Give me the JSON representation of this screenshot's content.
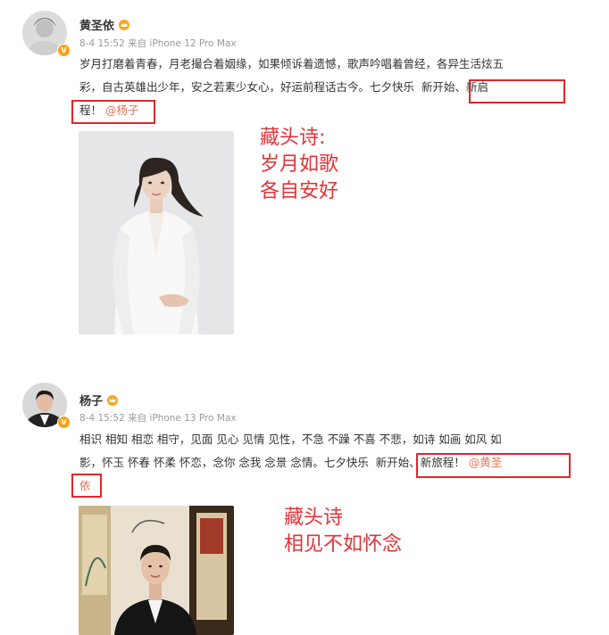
{
  "post1": {
    "username": "黄圣依",
    "meta": "8-4 15:52 来自 iPhone 12 Pro Max",
    "line1": "岁月打磨着青春，月老撮合着姻缘，如果倾诉着遗憾，歌声吟唱着曾经，各异生活炫五",
    "line2_a": "彩，自古英雄出少年，安之若素少女心，好运前程话古今。七夕快乐",
    "line2_b": "新开始、新启",
    "line3_a": "程！",
    "line3_mention": "@杨子",
    "annotation": [
      "藏头诗:",
      "岁月如歌",
      "各自安好"
    ]
  },
  "post2": {
    "username": "杨子",
    "meta": "8-4 15:52 来自 iPhone 13 Pro Max",
    "line1": "相识 相知 相恋 相守，见面 见心 见情 见性，不急 不躁 不喜 不悲，如诗 如画 如风 如",
    "line2_a": "影，怀玉 怀春 怀柔 怀恋，念你 念我 念景 念情。七夕快乐",
    "line2_b": "新开始、新旅程！",
    "line2_mention": "@黄圣",
    "line3_mention": "依",
    "annotation": [
      "藏头诗",
      "相见不如怀念"
    ]
  }
}
